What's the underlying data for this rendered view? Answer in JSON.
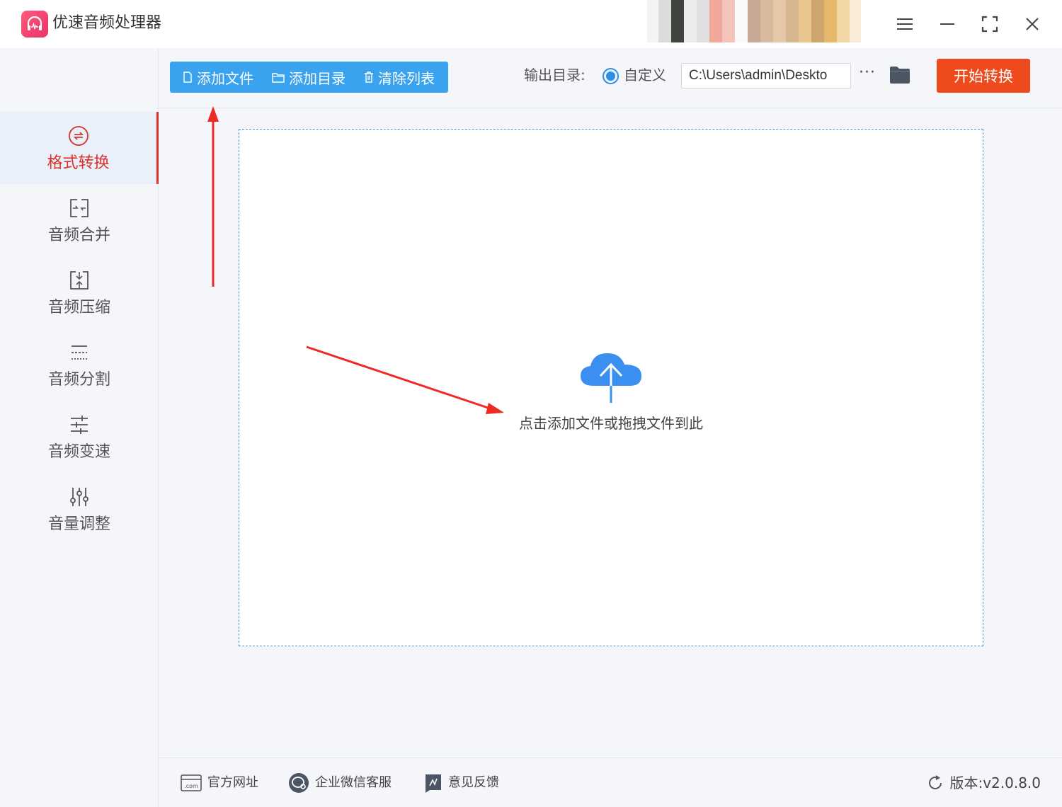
{
  "app": {
    "title": "优速音频处理器",
    "accent": "#d9322b"
  },
  "window_controls": [
    "menu-icon",
    "minimize-icon",
    "maximize-icon",
    "close-icon"
  ],
  "sidebar": {
    "items": [
      {
        "label": "格式转换",
        "icon": "convert-icon",
        "active": true
      },
      {
        "label": "音频合并",
        "icon": "merge-icon",
        "active": false
      },
      {
        "label": "音频压缩",
        "icon": "compress-icon",
        "active": false
      },
      {
        "label": "音频分割",
        "icon": "split-icon",
        "active": false
      },
      {
        "label": "音频变速",
        "icon": "speed-icon",
        "active": false
      },
      {
        "label": "音量调整",
        "icon": "volume-icon",
        "active": false
      }
    ]
  },
  "toolbar": {
    "add_file": "添加文件",
    "add_folder": "添加目录",
    "clear_list": "清除列表",
    "output_label": "输出目录:",
    "custom_label": "自定义",
    "output_path": "C:\\Users\\admin\\Deskto",
    "more": "···",
    "start_button": "开始转换",
    "start_color": "#ee4a1e",
    "button_group_color": "#3aa3f0"
  },
  "dropzone": {
    "hint": "点击添加文件或拖拽文件到此"
  },
  "footer": {
    "website": "官方网址",
    "wechat_support": "企业微信客服",
    "feedback": "意见反馈",
    "version": "版本:v2.0.8.0"
  }
}
